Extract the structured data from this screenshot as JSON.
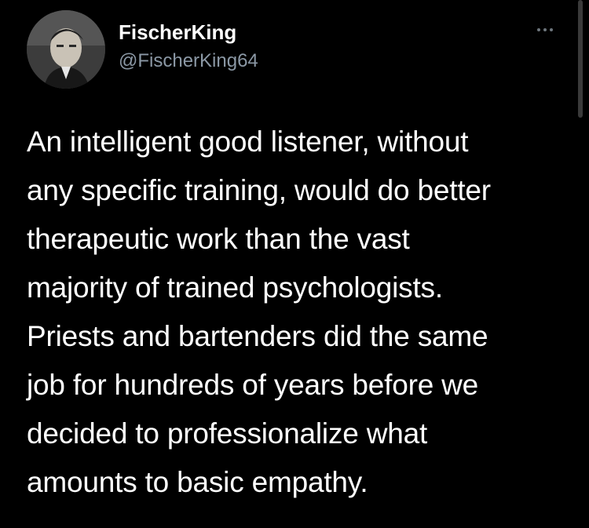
{
  "tweet": {
    "author": {
      "display_name": "FischerKing",
      "handle": "@FischerKing64",
      "avatar_icon": "profile-photo-icon"
    },
    "more_icon": "ellipsis-icon",
    "text": "An intelligent good listener, without\nany specific training, would do better\ntherapeutic work than the vast\nmajority of trained psychologists.\nPriests and bartenders did the same\njob for hundreds of years before we\ndecided to professionalize what\namounts to basic empathy."
  },
  "colors": {
    "background": "#000000",
    "primary_text": "#ffffff",
    "secondary_text": "#8b98a5"
  }
}
